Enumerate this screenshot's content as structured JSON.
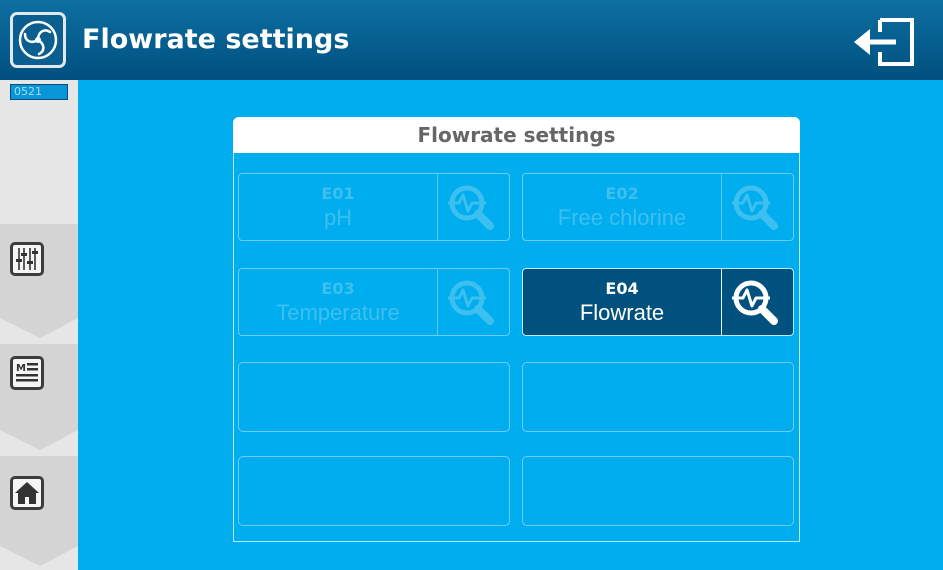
{
  "header": {
    "title": "Flowrate settings"
  },
  "sidebar": {
    "badge": "0521"
  },
  "panel": {
    "title": "Flowrate settings",
    "tiles": [
      {
        "code": "E01",
        "label": "pH",
        "active": false
      },
      {
        "code": "E02",
        "label": "Free chlorine",
        "active": false
      },
      {
        "code": "E03",
        "label": "Temperature",
        "active": false
      },
      {
        "code": "E04",
        "label": "Flowrate",
        "active": true
      }
    ]
  },
  "colors": {
    "header": "#00507f",
    "background": "#00adee",
    "active_tile": "#01517e",
    "sidebar": "#e6e6e6"
  },
  "icons": [
    "app-logo-icon",
    "exit-icon",
    "sliders-icon",
    "menu-list-icon",
    "home-icon",
    "magnifier-pulse-icon"
  ]
}
